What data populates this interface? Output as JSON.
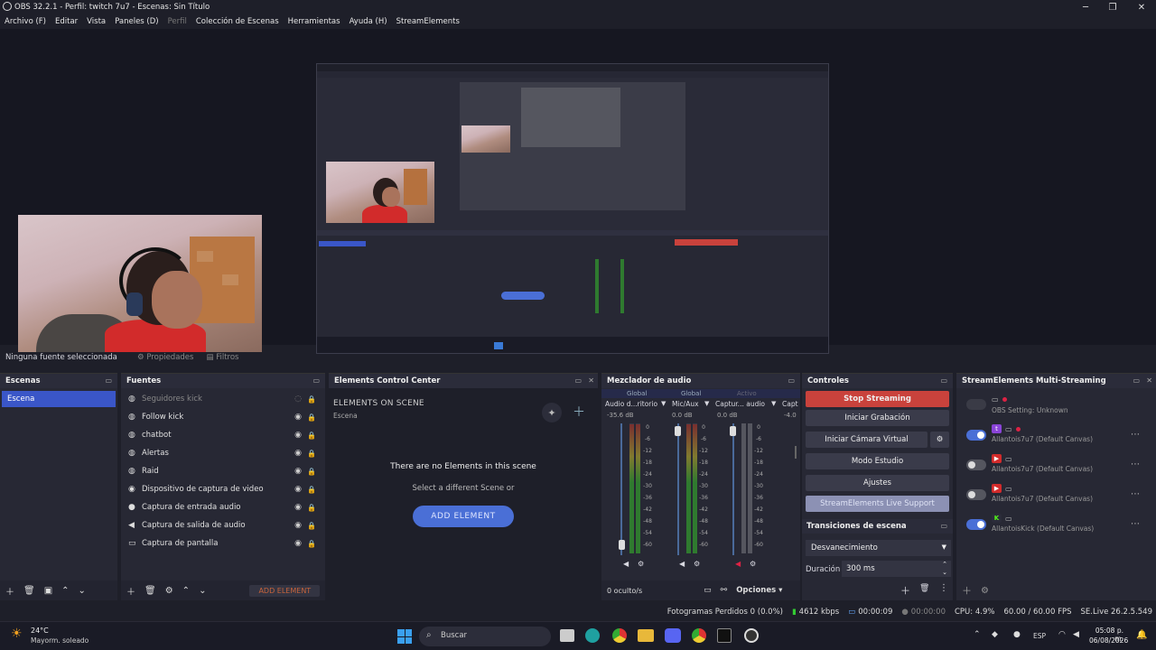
{
  "window": {
    "title": "OBS 32.2.1 - Perfil: twitch 7u7 - Escenas: Sin Título"
  },
  "menu": [
    {
      "label": "Archivo (F)",
      "enabled": true
    },
    {
      "label": "Editar",
      "enabled": true
    },
    {
      "label": "Vista",
      "enabled": true
    },
    {
      "label": "Paneles (D)",
      "enabled": true
    },
    {
      "label": "Perfil",
      "enabled": false
    },
    {
      "label": "Colección de Escenas",
      "enabled": true
    },
    {
      "label": "Herramientas",
      "enabled": true
    },
    {
      "label": "Ayuda (H)",
      "enabled": true
    },
    {
      "label": "StreamElements",
      "enabled": true
    }
  ],
  "context_bar": {
    "no_source": "Ninguna fuente seleccionada",
    "properties": "Propiedades",
    "filters": "Filtros"
  },
  "scenes": {
    "title": "Escenas",
    "items": [
      "Escena"
    ]
  },
  "sources": {
    "title": "Fuentes",
    "items": [
      {
        "label": "Seguidores kick",
        "icon": "globe-icon",
        "hidden": true
      },
      {
        "label": "Follow kick",
        "icon": "globe-icon",
        "hidden": false
      },
      {
        "label": "chatbot",
        "icon": "globe-icon",
        "hidden": false
      },
      {
        "label": "Alertas",
        "icon": "globe-icon",
        "hidden": false
      },
      {
        "label": "Raid",
        "icon": "globe-icon",
        "hidden": false
      },
      {
        "label": "Dispositivo de captura de video",
        "icon": "camera-icon",
        "hidden": false
      },
      {
        "label": "Captura de entrada audio",
        "icon": "mic-icon",
        "hidden": false
      },
      {
        "label": "Captura de salida de audio",
        "icon": "speaker-icon",
        "hidden": false
      },
      {
        "label": "Captura de pantalla",
        "icon": "monitor-icon",
        "hidden": false
      }
    ],
    "add_element": "ADD ELEMENT"
  },
  "ecc": {
    "title": "Elements Control Center",
    "heading": "ELEMENTS ON SCENE",
    "scene": "Escena",
    "empty": "There are no Elements in this scene",
    "hint": "Select a different Scene or",
    "button": "ADD ELEMENT"
  },
  "mixer": {
    "title": "Mezclador de audio",
    "tabs": [
      "Global",
      "Global",
      "Activo"
    ],
    "channels": [
      {
        "name": "Audio d...ritorio",
        "db": "-35.6 dB",
        "muted": false
      },
      {
        "name": "Mic/Aux",
        "db": "0.0 dB",
        "muted": false
      },
      {
        "name": "Captur... audio",
        "db": "0.0 dB",
        "muted": true
      },
      {
        "name": "Capt",
        "db": "-4.0",
        "muted": false
      }
    ],
    "scale": [
      "0",
      "-6",
      "-12",
      "-18",
      "-24",
      "-30",
      "-36",
      "-42",
      "-48",
      "-54",
      "-60"
    ],
    "hidden": "0 oculto/s",
    "options": "Opciones"
  },
  "controls": {
    "title": "Controles",
    "stop": "Stop Streaming",
    "record": "Iniciar Grabación",
    "vcam": "Iniciar Cámara Virtual",
    "studio": "Modo Estudio",
    "settings": "Ajustes",
    "support": "StreamElements Live Support"
  },
  "transitions": {
    "title": "Transiciones de escena",
    "type": "Desvanecimiento",
    "duration_label": "Duración",
    "duration": "300 ms"
  },
  "multistream": {
    "title": "StreamElements Multi-Streaming",
    "obs_setting": "OBS Setting: Unknown",
    "rows": [
      {
        "text": "Allantois7u7 (Default Canvas)",
        "platform": "twitch",
        "enabled": true
      },
      {
        "text": "Allantois7u7 (Default Canvas)",
        "platform": "youtube",
        "enabled": false
      },
      {
        "text": "Allantois7u7 (Default Canvas)",
        "platform": "youtube",
        "enabled": false
      },
      {
        "text": "AllantoisKick (Default Canvas)",
        "platform": "kick",
        "enabled": true
      }
    ]
  },
  "status": {
    "dropped": "Fotogramas Perdidos 0 (0.0%)",
    "bitrate": "4612 kbps",
    "stream_time": "00:00:09",
    "rec_time": "00:00:00",
    "cpu": "CPU: 4.9%",
    "fps": "60.00 / 60.00 FPS",
    "version": "SE.Live 26.2.5.549"
  },
  "taskbar": {
    "temp": "24°C",
    "weather": "Mayorm. soleado",
    "search": "Buscar",
    "lang": "ESP",
    "time": "05:08 p. m.",
    "date": "06/08/2026"
  },
  "colors": {
    "accent": "#3a56c8",
    "stop": "#c9423c",
    "panel": "#272834",
    "ecc_button": "#4a6fd6"
  }
}
